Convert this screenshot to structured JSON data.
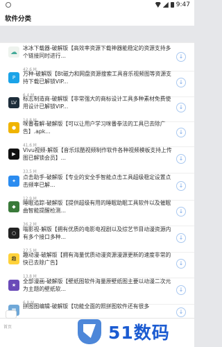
{
  "status": {
    "time": "9:47"
  },
  "header": {
    "title": "软件分类"
  },
  "items": [
    {
      "icon": "cloud-icon",
      "name": "冰冰下载器-破解版【高效率资源下载神器能稳定的资源支持多个链接同时进行...",
      "size": "42.6 M"
    },
    {
      "icon": "magnet-icon",
      "name": "万种-破解版【Bt磁力和网盘资源搜索工具音乐视频图等资源支持下载已解锁VIP...",
      "size": "6.4 M"
    },
    {
      "icon": "lv-icon",
      "name": "标志制造商-破解版【非常强大的商标设计工具多种素材免费使用设计已解锁VIP...",
      "size": "14.8 M"
    },
    {
      "icon": "avatar-icon",
      "name": "咪番看解-破解版【可以让用户学习咪番拳法的工具已去除广告】.apk...",
      "size": "41.6 M"
    },
    {
      "icon": "vivu-icon",
      "name": "Vivu视频-解版【音乐炫酷视频制作软件各种视频模板支持上传图已解锁会员】...",
      "size": "33.5 M"
    },
    {
      "icon": "click-icon",
      "name": "点击助手-破解版【专业的安全手智能点击工具超级稳定设置点击频率已解...",
      "size": "12.9 M"
    },
    {
      "icon": "sleep-icon",
      "name": "睡眠追踪-破解版【提供超级有用的睡眠助眠工具软件以及催眠曲智能提醒检测...",
      "size": "36.2 M"
    },
    {
      "icon": "ring-icon",
      "name": "嗡影视-解版【拥有优质的电影电视剧以及综艺节目动漫资源内有多个接口多种...",
      "size": "27.5 M"
    },
    {
      "icon": "comic-icon",
      "name": "趣动漫-破解版【拥有海量优质动漫资源漫源更新的速度非常的快已去除广告】",
      "size": "13.8 M"
    },
    {
      "icon": "anime-icon",
      "name": "全部漫画-破解版【壁纸图软件海量原壁纸图主要以动漫二次元为主题的壁纸软...",
      "size": "6.8 M"
    },
    {
      "icon": "photo-icon",
      "name": "拼图图编辑-破解版【功能全面的照拼图软件还有很多",
      "size": "18.1 M"
    }
  ],
  "nav": {
    "home_label": "首页"
  },
  "watermark": {
    "text": "51数码"
  }
}
